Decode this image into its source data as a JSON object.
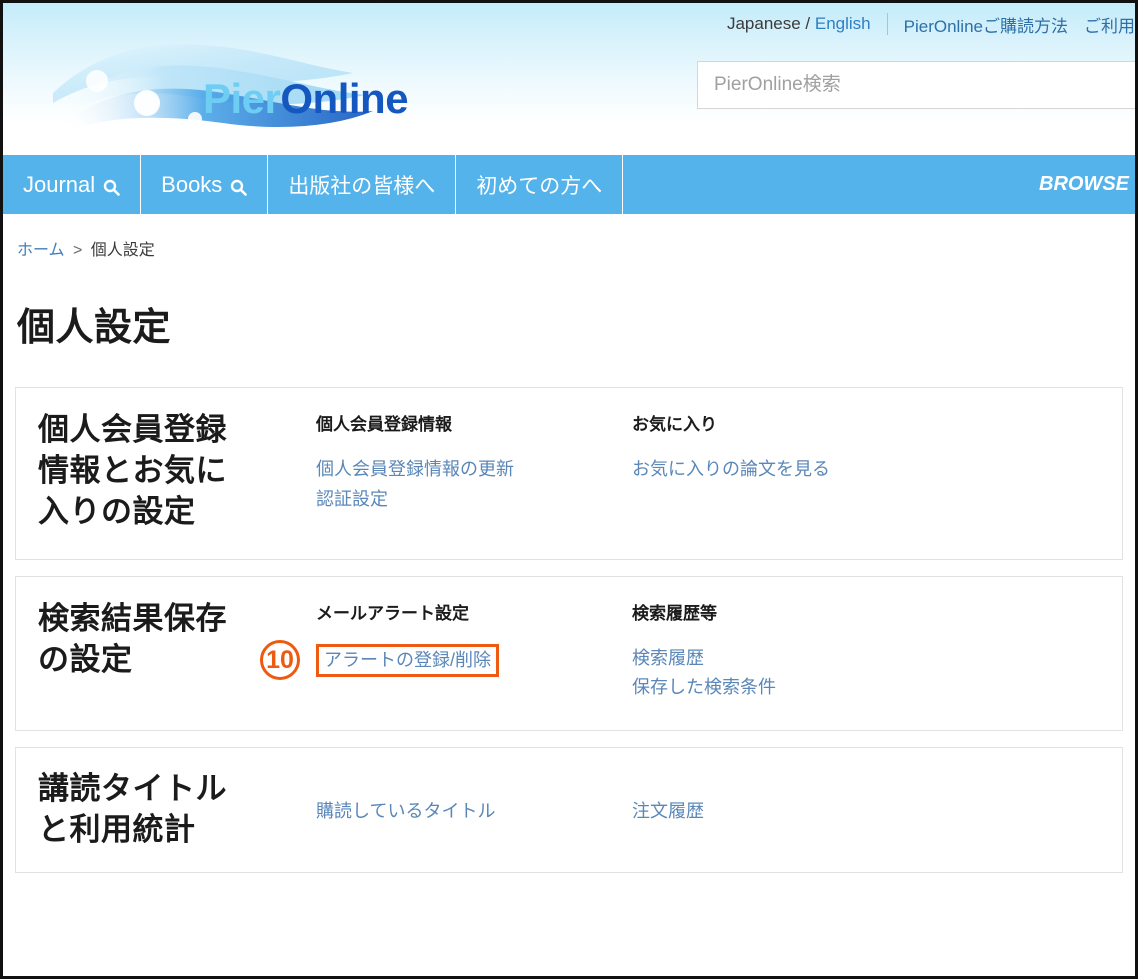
{
  "header": {
    "lang_jp": "Japanese",
    "lang_sep": " / ",
    "lang_en": "English",
    "links": [
      "PierOnlineご購読方法",
      "ご利用"
    ],
    "logo_pier": "Pier",
    "logo_online": "Online",
    "search_placeholder": "PierOnline検索",
    "search_value": ""
  },
  "nav": {
    "items": [
      {
        "label": "Journal",
        "icon": "search-icon"
      },
      {
        "label": "Books",
        "icon": "search-icon"
      },
      {
        "label": "出版社の皆様へ",
        "icon": ""
      },
      {
        "label": "初めての方へ",
        "icon": ""
      }
    ],
    "browse": "BROWSE"
  },
  "breadcrumb": {
    "home": "ホーム",
    "separator": ">",
    "current": "個人設定"
  },
  "page": {
    "title": "個人設定"
  },
  "sections": [
    {
      "title": "個人会員登録\n情報とお気に\n入りの設定",
      "columns": [
        {
          "head": "個人会員登録情報",
          "links": [
            "個人会員登録情報の更新",
            "認証設定"
          ]
        },
        {
          "head": "お気に入り",
          "links": [
            "お気に入りの論文を見る"
          ]
        }
      ]
    },
    {
      "title": "検索結果保存\nの設定",
      "columns": [
        {
          "head": "メールアラート設定",
          "links": [
            "アラートの登録/削除"
          ],
          "annotation": "10"
        },
        {
          "head": "検索履歴等",
          "links": [
            "検索履歴",
            "保存した検索条件"
          ]
        }
      ]
    },
    {
      "title": "講読タイトル\nと利用統計",
      "columns": [
        {
          "head": "",
          "links": [
            "購読しているタイトル"
          ]
        },
        {
          "head": "",
          "links": [
            "注文履歴"
          ]
        }
      ]
    }
  ],
  "colors": {
    "nav_blue": "#55b3ec",
    "link_blue": "#5a87b8",
    "annotation_orange": "#ee5a12",
    "logo_pier": "#6ecdf2",
    "logo_online": "#1457c0"
  }
}
